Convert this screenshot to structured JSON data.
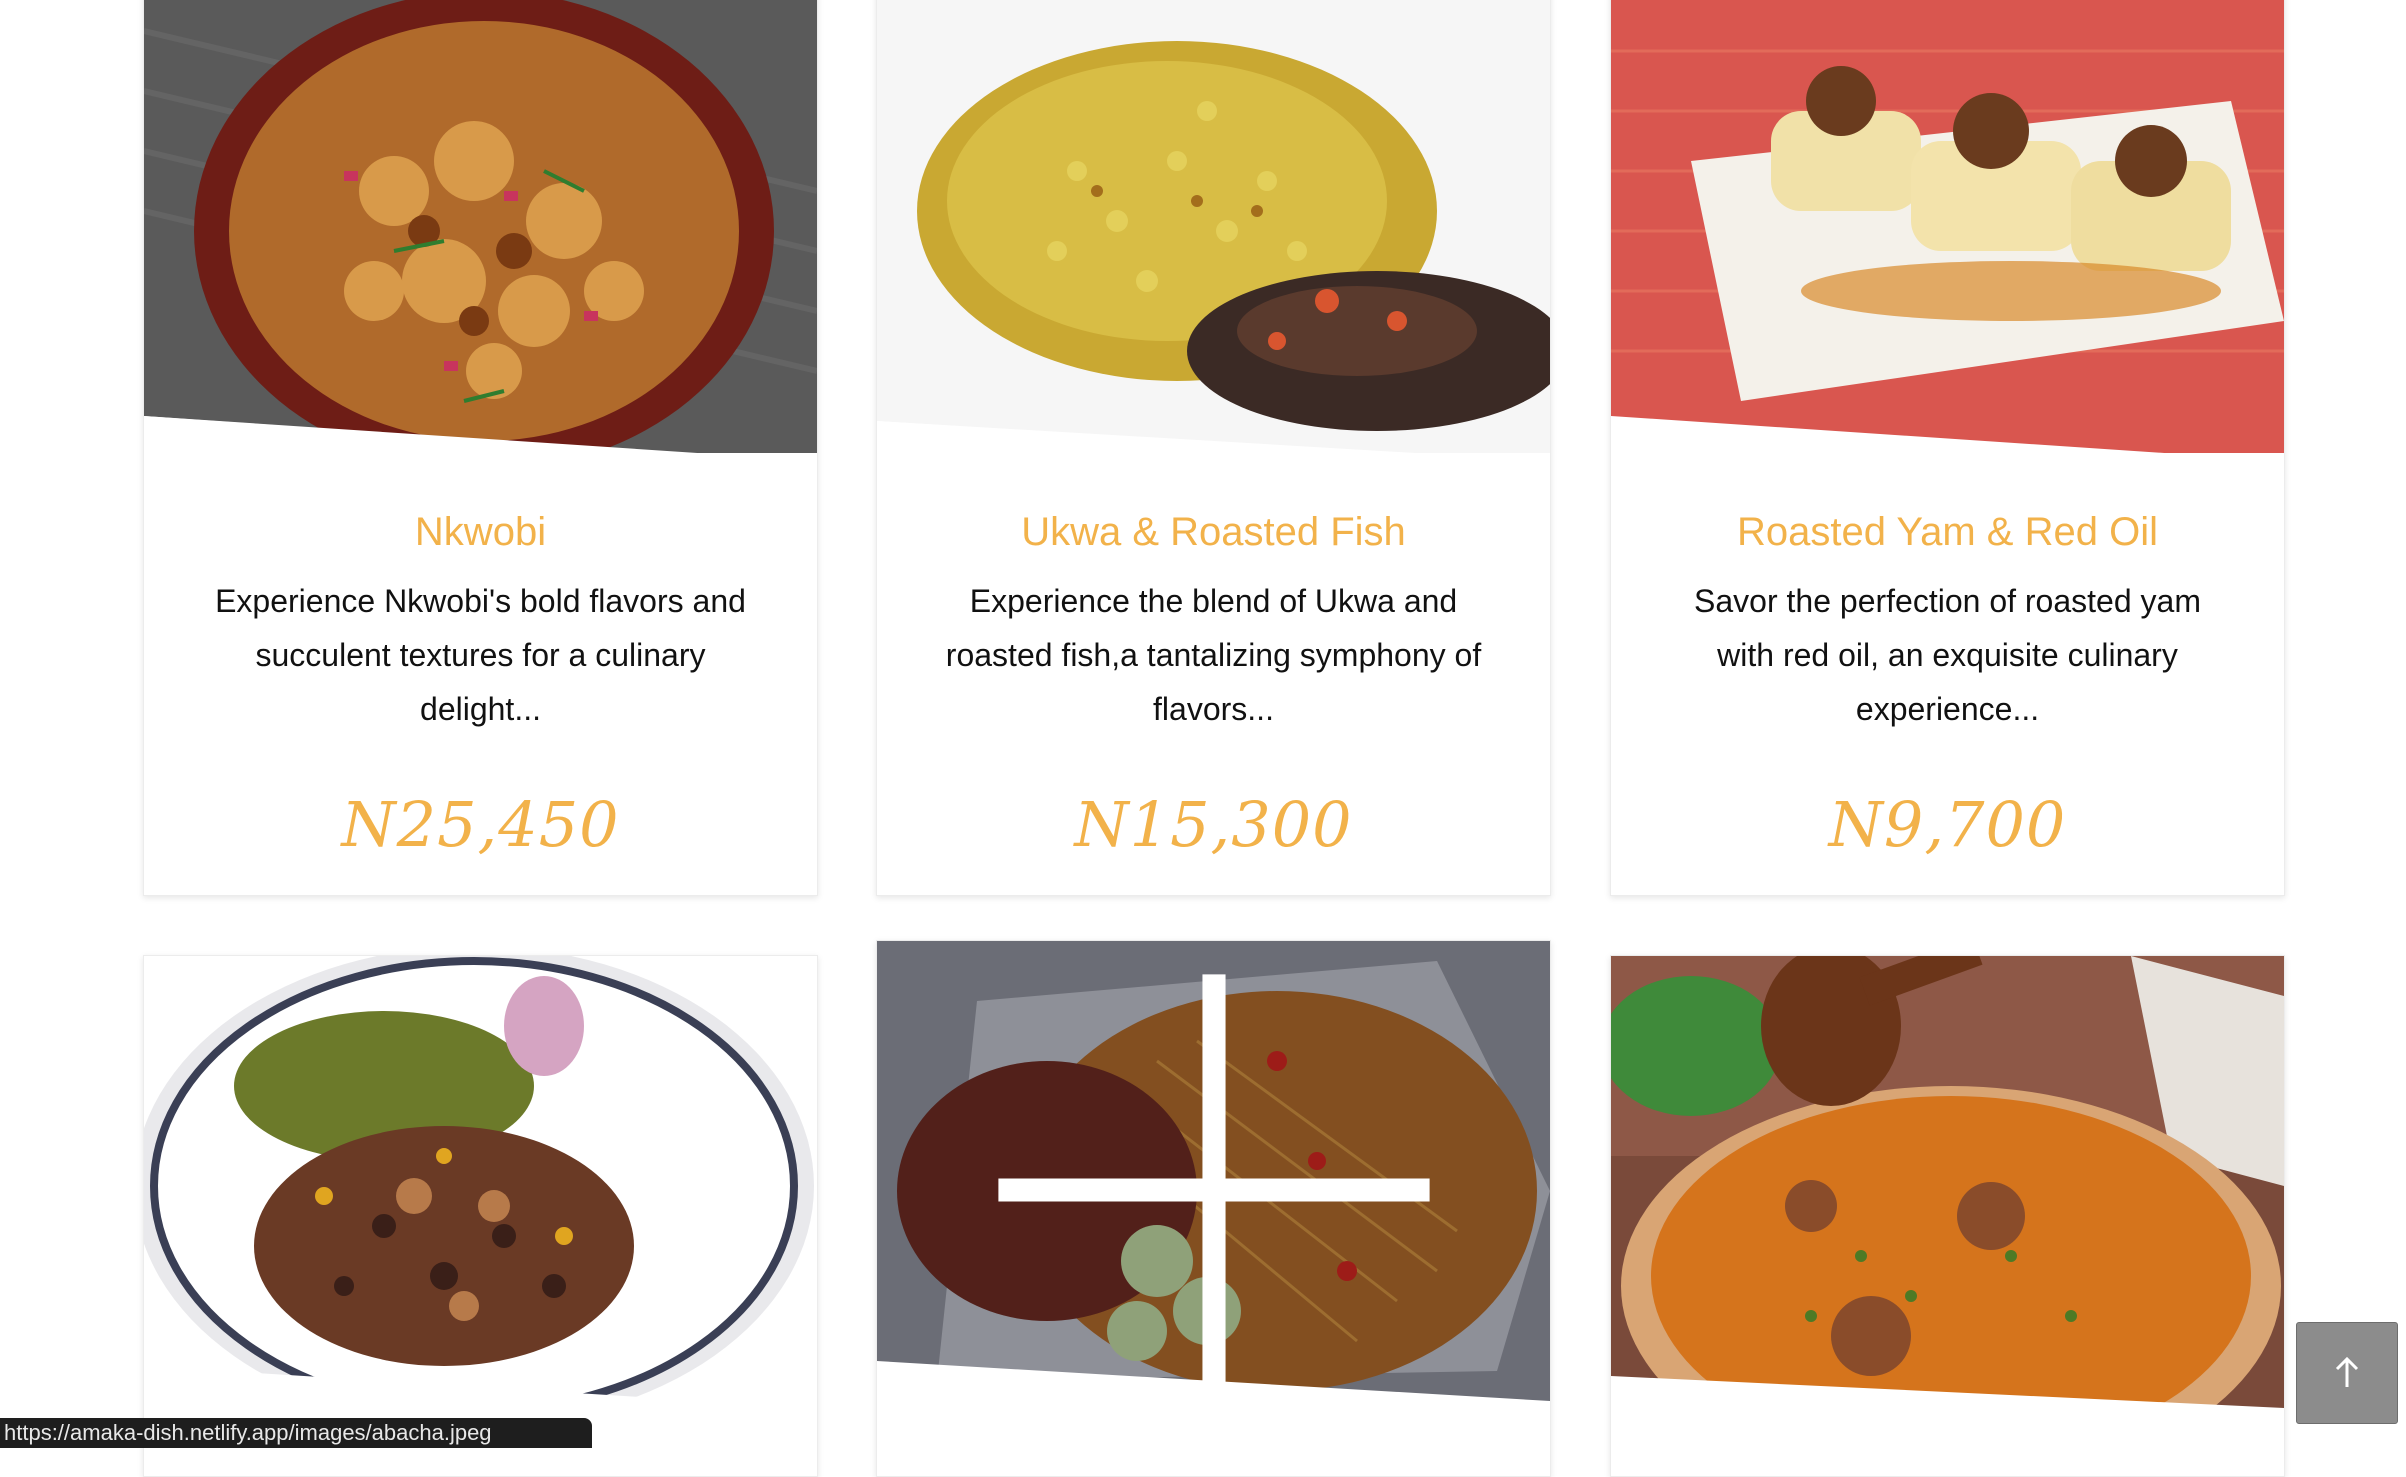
{
  "menu": {
    "items": [
      {
        "title": "Nkwobi",
        "description": "Experience Nkwobi's bold flavors and succulent textures for a culinary delight...",
        "price": "N25,450"
      },
      {
        "title": "Ukwa & Roasted Fish",
        "description": "Experience the blend of Ukwa and roasted fish,a tantalizing symphony of flavors...",
        "price": "N15,300"
      },
      {
        "title": "Roasted Yam & Red Oil",
        "description": "Savor the perfection of roasted yam with red oil, an exquisite culinary experience...",
        "price": "N9,700"
      }
    ],
    "accent_color": "#f2b24a"
  },
  "status_bar": {
    "url": "https://amaka-dish.netlify.app/images/abacha.jpeg"
  },
  "scroll_top": {
    "icon": "arrow-up-icon"
  },
  "hover_icon": "plus-icon"
}
